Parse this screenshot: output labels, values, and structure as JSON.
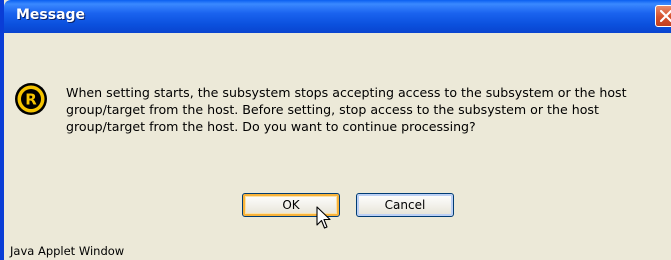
{
  "window": {
    "title": "Message",
    "close_icon": "close-x-icon"
  },
  "dialog": {
    "icon": "r-warning-icon",
    "message_lines": [
      "When setting starts, the subsystem stops accepting access to the subsystem or the host",
      "group/target from the host. Before setting, stop access to the subsystem or the host",
      "group/target from the host. Do you want to continue processing?"
    ],
    "buttons": {
      "ok_label": "OK",
      "cancel_label": "Cancel"
    }
  },
  "status_text": "Java Applet Window",
  "colors": {
    "titlebar": "#0A50DD",
    "dialog_bg": "#ECE9D8",
    "icon_fill": "#F5C400",
    "close_button": "#D5512C"
  }
}
